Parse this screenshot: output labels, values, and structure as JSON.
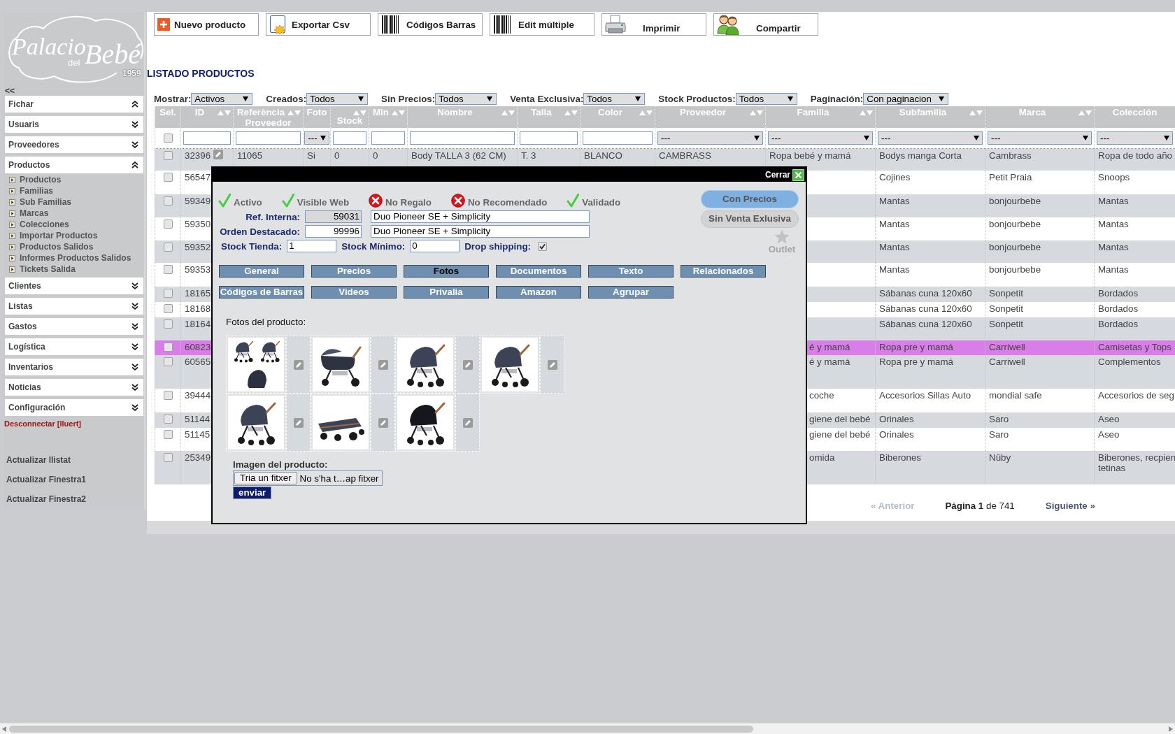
{
  "logo": {
    "texts": [
      "Palacio",
      "del",
      "Bebé"
    ],
    "year": "1959"
  },
  "sidebar": {
    "collapse": "<<",
    "sections": [
      {
        "label": "Fichar",
        "expanded": true
      },
      {
        "label": "Usuaris",
        "expanded": false
      },
      {
        "label": "Proveedores",
        "expanded": false
      },
      {
        "label": "Productos",
        "expanded": true,
        "children": [
          {
            "label": "Productos"
          },
          {
            "label": "Familias"
          },
          {
            "label": "Sub Familias"
          },
          {
            "label": "Marcas"
          },
          {
            "label": "Colecciones"
          },
          {
            "label": "Importar Productos"
          },
          {
            "label": "Productos Salidos"
          },
          {
            "label": "Informes Productos Salidos"
          },
          {
            "label": "Tickets Salida"
          }
        ]
      },
      {
        "label": "Clientes",
        "expanded": false
      },
      {
        "label": "Listas",
        "expanded": false
      },
      {
        "label": "Gastos",
        "expanded": false
      },
      {
        "label": "Logística",
        "expanded": false
      },
      {
        "label": "Inventarios",
        "expanded": false
      },
      {
        "label": "Noticias",
        "expanded": false
      },
      {
        "label": "Configuración",
        "expanded": false
      }
    ],
    "logout": "Desconnectar [lluert]",
    "actions": [
      "Actualizar llistat",
      "Actualizar Finestra1",
      "Actualizar Finestra2"
    ]
  },
  "toolbar": [
    "Nuevo producto",
    "Exportar Csv",
    "Códigos Barras",
    "Edit múltiple",
    "Imprimir",
    "Compartir"
  ],
  "page_title": "LISTADO PRODUCTOS",
  "filters": [
    {
      "label": "Mostrar:",
      "value": "Activos"
    },
    {
      "label": "Creados:",
      "value": "Todos"
    },
    {
      "label": "Sin Precios:",
      "value": "Todos"
    },
    {
      "label": "Venta Exclusiva:",
      "value": "Todos"
    },
    {
      "label": "Stock Productos:",
      "value": "Todos"
    },
    {
      "label": "Paginación:",
      "value": "Con paginacion"
    }
  ],
  "table": {
    "columns": [
      {
        "label": "Sel.",
        "sortable": false
      },
      {
        "label": "ID",
        "sortable": true
      },
      {
        "label": "Referència Proveedor",
        "sortable": true
      },
      {
        "label": "Foto",
        "sortable": false
      },
      {
        "label": "Stock",
        "sortable": true
      },
      {
        "label": "Min",
        "sortable": true
      },
      {
        "label": "Nombre",
        "sortable": true
      },
      {
        "label": "Talla",
        "sortable": true
      },
      {
        "label": "Color",
        "sortable": true
      },
      {
        "label": "Proveedor",
        "sortable": true
      },
      {
        "label": "Familia",
        "sortable": true
      },
      {
        "label": "Subfamilia",
        "sortable": true
      },
      {
        "label": "Marca",
        "sortable": true
      },
      {
        "label": "Colección",
        "sortable": false
      }
    ],
    "filter_row": [
      {
        "kind": "checkbox",
        "checked": false
      },
      {
        "kind": "text"
      },
      {
        "kind": "text"
      },
      {
        "kind": "select",
        "value": "---"
      },
      {
        "kind": "text"
      },
      {
        "kind": "text"
      },
      {
        "kind": "text"
      },
      {
        "kind": "text"
      },
      {
        "kind": "text"
      },
      {
        "kind": "select",
        "value": "---"
      },
      {
        "kind": "select",
        "value": "---"
      },
      {
        "kind": "select",
        "value": "---"
      },
      {
        "kind": "select",
        "value": "---"
      },
      {
        "kind": "select",
        "value": "---"
      }
    ],
    "rows": [
      {
        "kind": "full",
        "checked": false,
        "highlighted": false,
        "id": "32396",
        "referencia": "11065",
        "foto": "Si",
        "stock": "0",
        "min": "0",
        "nombre": "Body TALLA 3 (62 CM)",
        "talla": "T. 3",
        "color_text": "BLANCO",
        "proveedor": "CAMBRASS",
        "familia": "Ropa bebé y mamá",
        "subfamilia": "Bodys manga Corta",
        "marca": "Cambrass",
        "coleccion": "Ropa de todo año"
      },
      {
        "kind": "covered",
        "checked": false,
        "highlighted": false,
        "id": "56547",
        "subfamilia": "Cojines",
        "marca": "Petit Praia",
        "coleccion": "Snoops"
      },
      {
        "kind": "covered",
        "checked": false,
        "highlighted": false,
        "id": "59349",
        "subfamilia": "Mantas",
        "marca": "bonjourbebe",
        "coleccion": "Mantas"
      },
      {
        "kind": "covered",
        "checked": false,
        "highlighted": false,
        "id": "59350",
        "subfamilia": "Mantas",
        "marca": "bonjourbebe",
        "coleccion": "Mantas"
      },
      {
        "kind": "covered",
        "checked": false,
        "highlighted": false,
        "id": "59352",
        "subfamilia": "Mantas",
        "marca": "bonjourbebe",
        "coleccion": "Mantas"
      },
      {
        "kind": "covered",
        "checked": false,
        "highlighted": false,
        "id": "59353",
        "subfamilia": "Mantas",
        "marca": "bonjourbebe",
        "coleccion": "Mantas"
      },
      {
        "kind": "covered",
        "checked": false,
        "highlighted": false,
        "id": "18165",
        "subfamilia": "Sábanas cuna 120x60",
        "marca": "Sonpetit",
        "coleccion": "Bordados"
      },
      {
        "kind": "covered",
        "checked": false,
        "highlighted": false,
        "id": "18168",
        "subfamilia": "Sábanas cuna 120x60",
        "marca": "Sonpetit",
        "coleccion": "Bordados"
      },
      {
        "kind": "covered",
        "checked": false,
        "highlighted": false,
        "id": "18164",
        "subfamilia": "Sábanas cuna 120x60",
        "marca": "Sonpetit",
        "coleccion": "Bordados"
      },
      {
        "kind": "covered",
        "checked": false,
        "highlighted": true,
        "id": "60823",
        "familia": "é y mamá",
        "subfamilia": "Ropa pre y mamá",
        "marca": "Carriwell",
        "coleccion": "Camisetas y Tops"
      },
      {
        "kind": "covered",
        "checked": false,
        "highlighted": false,
        "id": "60565",
        "familia": "é y mamá",
        "subfamilia": "Ropa pre y mamá",
        "marca": "Carriwell",
        "coleccion": "Complementos"
      },
      {
        "kind": "covered",
        "checked": false,
        "highlighted": false,
        "id": "39444",
        "familia": "coche",
        "subfamilia": "Accesorios Sillas Auto",
        "marca": "mondial safe",
        "coleccion": "Accesorios de seg"
      },
      {
        "kind": "covered",
        "checked": false,
        "highlighted": false,
        "id": "51144",
        "familia": "giene del bebé",
        "subfamilia": "Orinales",
        "marca": "Saro",
        "coleccion": "Aseo"
      },
      {
        "kind": "covered",
        "checked": false,
        "highlighted": false,
        "id": "51145",
        "familia": "giene del bebé",
        "subfamilia": "Orinales",
        "marca": "Saro",
        "coleccion": "Aseo"
      },
      {
        "kind": "covered",
        "checked": false,
        "highlighted": false,
        "id": "25349",
        "familia": "omida",
        "subfamilia": "Biberones",
        "marca": "Nûby",
        "coleccion": "Biberones, recpien\ntetinas"
      }
    ]
  },
  "pagination": {
    "previous": {
      "label": "« Anterior",
      "disabled": true
    },
    "status": "**Página 1** de 741",
    "next": {
      "label": "Siguiente »",
      "disabled": false
    }
  },
  "modal": {
    "close": "Cerrar",
    "flags": [
      {
        "label": "Activo",
        "on": true
      },
      {
        "label": "Visible Web",
        "on": true
      },
      {
        "label": "No Regalo",
        "on": false
      },
      {
        "label": "No Recomendado",
        "on": false
      },
      {
        "label": "Validado",
        "on": true
      }
    ],
    "fields": [
      {
        "label": "Ref. Interna:",
        "code": "59031",
        "disabled": true,
        "name": "Duo Pioneer SE + Simplicity"
      },
      {
        "label": "Orden Destacado:",
        "code": "99996",
        "disabled": false,
        "name": "Duo Pioneer SE + Simplicity"
      }
    ],
    "stock": [
      {
        "label": "Stock Tienda:",
        "value": "1"
      },
      {
        "label": "Stock Mínimo:",
        "value": "0"
      }
    ],
    "drop_shipping": {
      "label": "Drop shipping:",
      "checked": true
    },
    "toggles": [
      {
        "label": "Con Precios",
        "on": true
      },
      {
        "label": "Sin Venta Exlusiva",
        "on": false
      }
    ],
    "outlet": {
      "label": "Outlet",
      "on": false
    },
    "tab_rows": [
      [
        {
          "label": "General",
          "selected": false
        },
        {
          "label": "Precios",
          "selected": false
        },
        {
          "label": "Fotos",
          "selected": true
        },
        {
          "label": "Documentos",
          "selected": false
        },
        {
          "label": "Texto",
          "selected": false
        },
        {
          "label": "Relacionados",
          "selected": false
        }
      ],
      [
        {
          "label": "Códigos de Barras",
          "selected": false
        },
        {
          "label": "Videos",
          "selected": false
        },
        {
          "label": "Privalia",
          "selected": false
        },
        {
          "label": "Amazon",
          "selected": false
        },
        {
          "label": "Agrupar",
          "selected": false
        }
      ]
    ],
    "photos_title": "Fotos del producto:",
    "photos": [
      {
        "kind": "set"
      },
      {
        "kind": "carrycot"
      },
      {
        "kind": "stroller"
      },
      {
        "kind": "stroller"
      },
      {
        "kind": "stroller"
      },
      {
        "kind": "folded"
      },
      {
        "kind": "car-seat"
      }
    ],
    "upload": {
      "label": "Imagen del producto:",
      "button": "Tria un fitxer",
      "status": "No s'ha t…ap fitxer",
      "submit": "enviar"
    }
  }
}
